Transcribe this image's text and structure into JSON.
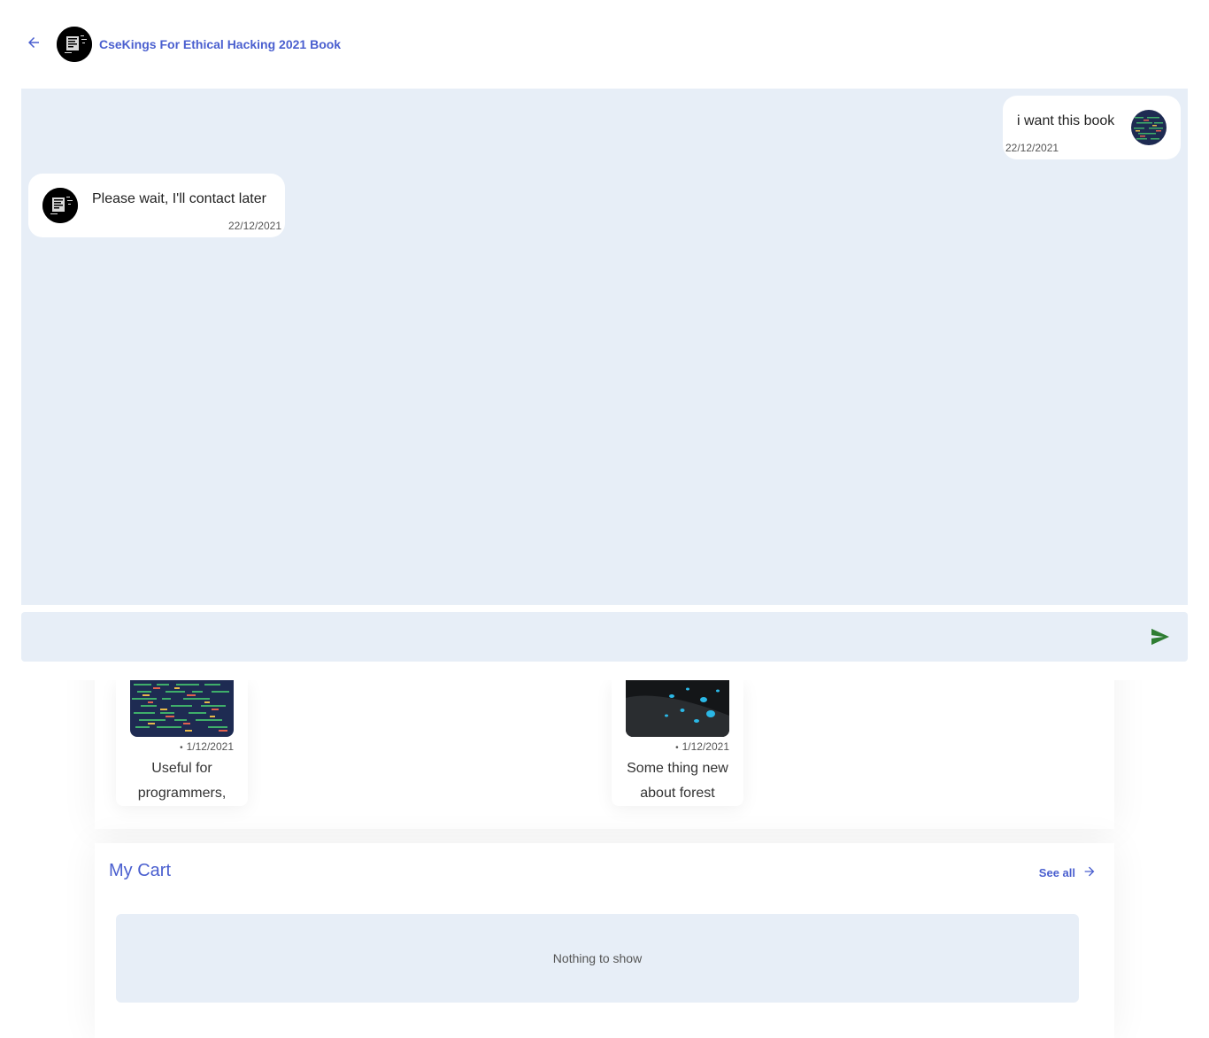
{
  "chat": {
    "title": "CseKings For Ethical Hacking 2021 Book",
    "messages": [
      {
        "direction": "outgoing",
        "text": "i want this book",
        "time": "22/12/2021"
      },
      {
        "direction": "incoming",
        "text": "Please wait, I'll contact later",
        "time": "22/12/2021"
      }
    ],
    "composer": {
      "placeholder": "",
      "value": ""
    },
    "icons": {
      "back": "arrow-left-icon",
      "send": "send-icon"
    },
    "colors": {
      "accent": "#4a5fcf",
      "panel": "#e7eef7",
      "send": "#2e7d32"
    }
  },
  "posts": [
    {
      "date": "1/12/2021",
      "title": "Useful for programmers,"
    },
    {
      "date": "1/12/2021",
      "title": "Some thing new about forest"
    }
  ],
  "cart": {
    "title": "My Cart",
    "see_all": "See all",
    "empty_text": "Nothing to show"
  }
}
